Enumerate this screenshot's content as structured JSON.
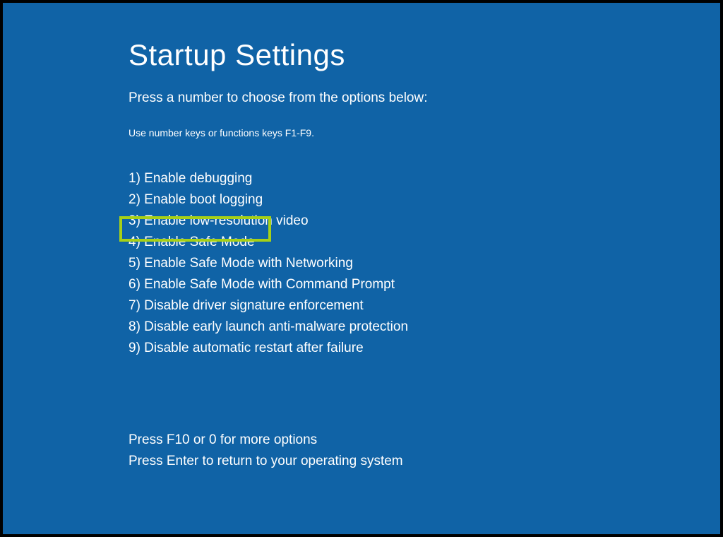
{
  "title": "Startup Settings",
  "instruction": "Press a number to choose from the options below:",
  "hint": "Use number keys or functions keys F1-F9.",
  "options": [
    "1) Enable debugging",
    "2) Enable boot logging",
    "3) Enable low-resolution video",
    "4) Enable Safe Mode",
    "5) Enable Safe Mode with Networking",
    "6) Enable Safe Mode with Command Prompt",
    "7) Disable driver signature enforcement",
    "8) Disable early launch anti-malware protection",
    "9) Disable automatic restart after failure"
  ],
  "footer": {
    "more": "Press F10 or 0 for more options",
    "return": "Press Enter to return to your operating system"
  }
}
